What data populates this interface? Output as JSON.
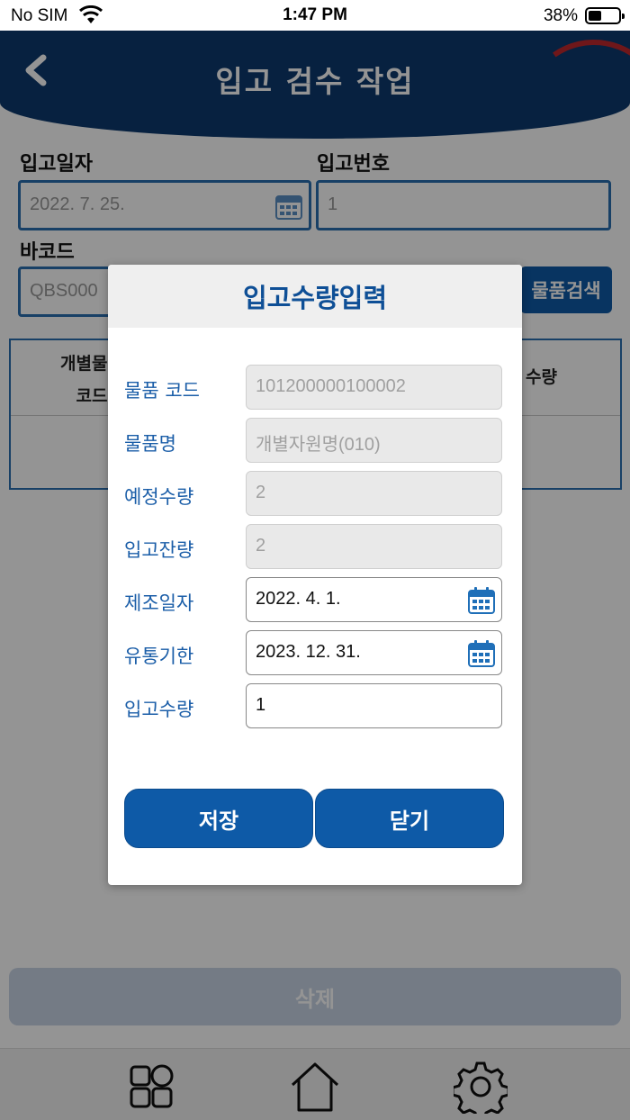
{
  "status": {
    "carrier": "No SIM",
    "time": "1:47 PM",
    "battery": "38%"
  },
  "header": {
    "title": "입고 검수 작업"
  },
  "form": {
    "date_label": "입고일자",
    "date_value": "2022. 7. 25.",
    "number_label": "입고번호",
    "number_value": "1",
    "barcode_label": "바코드",
    "barcode_value": "QBS000",
    "search_button": "물품검색"
  },
  "table": {
    "col1_line1": "개별물품",
    "col1_line2": "코드",
    "col2": "수량"
  },
  "delete_button": "삭제",
  "modal": {
    "title": "입고수량입력",
    "rows": [
      {
        "label": "물품 코드",
        "value": "101200000100002"
      },
      {
        "label": "물품명",
        "value": "개별자원명(010)"
      },
      {
        "label": "예정수량",
        "value": "2"
      },
      {
        "label": "입고잔량",
        "value": "2"
      },
      {
        "label": "제조일자",
        "value": "2022. 4. 1."
      },
      {
        "label": "유통기한",
        "value": "2023. 12. 31."
      },
      {
        "label": "입고수량",
        "value": "1"
      }
    ],
    "save_button": "저장",
    "close_button": "닫기"
  },
  "tabs": [
    "apps-icon",
    "home-icon",
    "gear-icon"
  ],
  "colors": {
    "primary": "#0e5aa7",
    "header": "#0d3a6e",
    "label": "#1b5ea8"
  }
}
